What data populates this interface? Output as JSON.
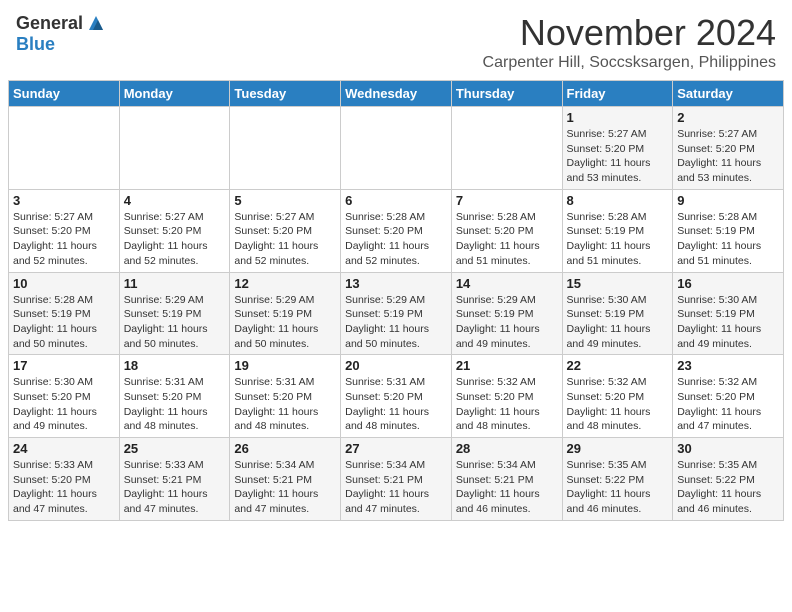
{
  "header": {
    "logo_general": "General",
    "logo_blue": "Blue",
    "month_title": "November 2024",
    "location": "Carpenter Hill, Soccsksargen, Philippines"
  },
  "calendar": {
    "days_of_week": [
      "Sunday",
      "Monday",
      "Tuesday",
      "Wednesday",
      "Thursday",
      "Friday",
      "Saturday"
    ],
    "weeks": [
      [
        {
          "day": "",
          "info": ""
        },
        {
          "day": "",
          "info": ""
        },
        {
          "day": "",
          "info": ""
        },
        {
          "day": "",
          "info": ""
        },
        {
          "day": "",
          "info": ""
        },
        {
          "day": "1",
          "info": "Sunrise: 5:27 AM\nSunset: 5:20 PM\nDaylight: 11 hours and 53 minutes."
        },
        {
          "day": "2",
          "info": "Sunrise: 5:27 AM\nSunset: 5:20 PM\nDaylight: 11 hours and 53 minutes."
        }
      ],
      [
        {
          "day": "3",
          "info": "Sunrise: 5:27 AM\nSunset: 5:20 PM\nDaylight: 11 hours and 52 minutes."
        },
        {
          "day": "4",
          "info": "Sunrise: 5:27 AM\nSunset: 5:20 PM\nDaylight: 11 hours and 52 minutes."
        },
        {
          "day": "5",
          "info": "Sunrise: 5:27 AM\nSunset: 5:20 PM\nDaylight: 11 hours and 52 minutes."
        },
        {
          "day": "6",
          "info": "Sunrise: 5:28 AM\nSunset: 5:20 PM\nDaylight: 11 hours and 52 minutes."
        },
        {
          "day": "7",
          "info": "Sunrise: 5:28 AM\nSunset: 5:20 PM\nDaylight: 11 hours and 51 minutes."
        },
        {
          "day": "8",
          "info": "Sunrise: 5:28 AM\nSunset: 5:19 PM\nDaylight: 11 hours and 51 minutes."
        },
        {
          "day": "9",
          "info": "Sunrise: 5:28 AM\nSunset: 5:19 PM\nDaylight: 11 hours and 51 minutes."
        }
      ],
      [
        {
          "day": "10",
          "info": "Sunrise: 5:28 AM\nSunset: 5:19 PM\nDaylight: 11 hours and 50 minutes."
        },
        {
          "day": "11",
          "info": "Sunrise: 5:29 AM\nSunset: 5:19 PM\nDaylight: 11 hours and 50 minutes."
        },
        {
          "day": "12",
          "info": "Sunrise: 5:29 AM\nSunset: 5:19 PM\nDaylight: 11 hours and 50 minutes."
        },
        {
          "day": "13",
          "info": "Sunrise: 5:29 AM\nSunset: 5:19 PM\nDaylight: 11 hours and 50 minutes."
        },
        {
          "day": "14",
          "info": "Sunrise: 5:29 AM\nSunset: 5:19 PM\nDaylight: 11 hours and 49 minutes."
        },
        {
          "day": "15",
          "info": "Sunrise: 5:30 AM\nSunset: 5:19 PM\nDaylight: 11 hours and 49 minutes."
        },
        {
          "day": "16",
          "info": "Sunrise: 5:30 AM\nSunset: 5:19 PM\nDaylight: 11 hours and 49 minutes."
        }
      ],
      [
        {
          "day": "17",
          "info": "Sunrise: 5:30 AM\nSunset: 5:20 PM\nDaylight: 11 hours and 49 minutes."
        },
        {
          "day": "18",
          "info": "Sunrise: 5:31 AM\nSunset: 5:20 PM\nDaylight: 11 hours and 48 minutes."
        },
        {
          "day": "19",
          "info": "Sunrise: 5:31 AM\nSunset: 5:20 PM\nDaylight: 11 hours and 48 minutes."
        },
        {
          "day": "20",
          "info": "Sunrise: 5:31 AM\nSunset: 5:20 PM\nDaylight: 11 hours and 48 minutes."
        },
        {
          "day": "21",
          "info": "Sunrise: 5:32 AM\nSunset: 5:20 PM\nDaylight: 11 hours and 48 minutes."
        },
        {
          "day": "22",
          "info": "Sunrise: 5:32 AM\nSunset: 5:20 PM\nDaylight: 11 hours and 48 minutes."
        },
        {
          "day": "23",
          "info": "Sunrise: 5:32 AM\nSunset: 5:20 PM\nDaylight: 11 hours and 47 minutes."
        }
      ],
      [
        {
          "day": "24",
          "info": "Sunrise: 5:33 AM\nSunset: 5:20 PM\nDaylight: 11 hours and 47 minutes."
        },
        {
          "day": "25",
          "info": "Sunrise: 5:33 AM\nSunset: 5:21 PM\nDaylight: 11 hours and 47 minutes."
        },
        {
          "day": "26",
          "info": "Sunrise: 5:34 AM\nSunset: 5:21 PM\nDaylight: 11 hours and 47 minutes."
        },
        {
          "day": "27",
          "info": "Sunrise: 5:34 AM\nSunset: 5:21 PM\nDaylight: 11 hours and 47 minutes."
        },
        {
          "day": "28",
          "info": "Sunrise: 5:34 AM\nSunset: 5:21 PM\nDaylight: 11 hours and 46 minutes."
        },
        {
          "day": "29",
          "info": "Sunrise: 5:35 AM\nSunset: 5:22 PM\nDaylight: 11 hours and 46 minutes."
        },
        {
          "day": "30",
          "info": "Sunrise: 5:35 AM\nSunset: 5:22 PM\nDaylight: 11 hours and 46 minutes."
        }
      ]
    ]
  }
}
